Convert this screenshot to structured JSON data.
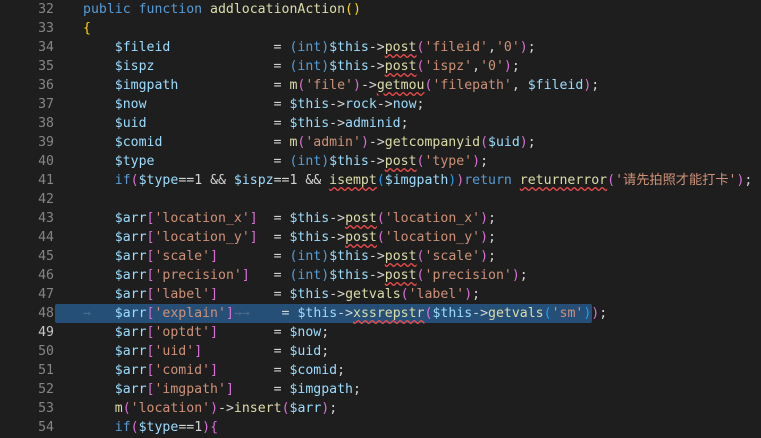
{
  "lines": [
    {
      "n": "32",
      "tokens": [
        [
          "",
          "kw",
          "public function "
        ],
        [
          "",
          "fn",
          "addlocationAction"
        ],
        [
          "",
          "br1",
          "()"
        ]
      ]
    },
    {
      "n": "33",
      "tokens": [
        [
          "",
          "br1",
          "{"
        ]
      ]
    },
    {
      "n": "34",
      "tokens": [
        [
          "",
          "plain",
          "    "
        ],
        [
          "",
          "var",
          "$fileid"
        ],
        [
          "",
          "plain",
          "             = "
        ],
        [
          "",
          "kw",
          "(int)"
        ],
        [
          "",
          "var",
          "$this"
        ],
        [
          "",
          "op",
          "->"
        ],
        [
          "",
          "fn squig",
          "post"
        ],
        [
          "",
          "br2",
          "("
        ],
        [
          "",
          "str",
          "'fileid'"
        ],
        [
          "",
          "plain",
          ","
        ],
        [
          "",
          "str",
          "'0'"
        ],
        [
          "",
          "br2",
          ")"
        ],
        [
          "",
          "plain",
          ";"
        ]
      ]
    },
    {
      "n": "35",
      "tokens": [
        [
          "",
          "plain",
          "    "
        ],
        [
          "",
          "var",
          "$ispz"
        ],
        [
          "",
          "plain",
          "               = "
        ],
        [
          "",
          "kw",
          "(int)"
        ],
        [
          "",
          "var",
          "$this"
        ],
        [
          "",
          "op",
          "->"
        ],
        [
          "",
          "fn squig",
          "post"
        ],
        [
          "",
          "br2",
          "("
        ],
        [
          "",
          "str",
          "'ispz'"
        ],
        [
          "",
          "plain",
          ","
        ],
        [
          "",
          "str",
          "'0'"
        ],
        [
          "",
          "br2",
          ")"
        ],
        [
          "",
          "plain",
          ";"
        ]
      ]
    },
    {
      "n": "36",
      "tokens": [
        [
          "",
          "plain",
          "    "
        ],
        [
          "",
          "var",
          "$imgpath"
        ],
        [
          "",
          "plain",
          "            = "
        ],
        [
          "",
          "fn",
          "m"
        ],
        [
          "",
          "br2",
          "("
        ],
        [
          "",
          "str",
          "'file'"
        ],
        [
          "",
          "br2",
          ")"
        ],
        [
          "",
          "op",
          "->"
        ],
        [
          "",
          "fn squig",
          "getmou"
        ],
        [
          "",
          "br2",
          "("
        ],
        [
          "",
          "str",
          "'filepath'"
        ],
        [
          "",
          "plain",
          ", "
        ],
        [
          "",
          "var",
          "$fileid"
        ],
        [
          "",
          "br2",
          ")"
        ],
        [
          "",
          "plain",
          ";"
        ]
      ]
    },
    {
      "n": "37",
      "tokens": [
        [
          "",
          "plain",
          "    "
        ],
        [
          "",
          "var",
          "$now"
        ],
        [
          "",
          "plain",
          "                = "
        ],
        [
          "",
          "var",
          "$this"
        ],
        [
          "",
          "op",
          "->"
        ],
        [
          "",
          "var",
          "rock"
        ],
        [
          "",
          "op",
          "->"
        ],
        [
          "",
          "var",
          "now"
        ],
        [
          "",
          "plain",
          ";"
        ]
      ]
    },
    {
      "n": "38",
      "tokens": [
        [
          "",
          "plain",
          "    "
        ],
        [
          "",
          "var",
          "$uid"
        ],
        [
          "",
          "plain",
          "                = "
        ],
        [
          "",
          "var",
          "$this"
        ],
        [
          "",
          "op",
          "->"
        ],
        [
          "",
          "var",
          "adminid"
        ],
        [
          "",
          "plain",
          ";"
        ]
      ]
    },
    {
      "n": "39",
      "tokens": [
        [
          "",
          "plain",
          "    "
        ],
        [
          "",
          "var",
          "$comid"
        ],
        [
          "",
          "plain",
          "              = "
        ],
        [
          "",
          "fn",
          "m"
        ],
        [
          "",
          "br2",
          "("
        ],
        [
          "",
          "str",
          "'admin'"
        ],
        [
          "",
          "br2",
          ")"
        ],
        [
          "",
          "op",
          "->"
        ],
        [
          "",
          "fn",
          "getcompanyid"
        ],
        [
          "",
          "br2",
          "("
        ],
        [
          "",
          "var",
          "$uid"
        ],
        [
          "",
          "br2",
          ")"
        ],
        [
          "",
          "plain",
          ";"
        ]
      ]
    },
    {
      "n": "40",
      "tokens": [
        [
          "",
          "plain",
          "    "
        ],
        [
          "",
          "var",
          "$type"
        ],
        [
          "",
          "plain",
          "               = "
        ],
        [
          "",
          "kw",
          "(int)"
        ],
        [
          "",
          "var",
          "$this"
        ],
        [
          "",
          "op",
          "->"
        ],
        [
          "",
          "fn squig",
          "post"
        ],
        [
          "",
          "br2",
          "("
        ],
        [
          "",
          "str",
          "'type'"
        ],
        [
          "",
          "br2",
          ")"
        ],
        [
          "",
          "plain",
          ";"
        ]
      ]
    },
    {
      "n": "41",
      "tokens": [
        [
          "",
          "plain",
          "    "
        ],
        [
          "",
          "kw",
          "if"
        ],
        [
          "",
          "br2",
          "("
        ],
        [
          "",
          "var",
          "$type"
        ],
        [
          "",
          "plain",
          "==1 && "
        ],
        [
          "",
          "var",
          "$ispz"
        ],
        [
          "",
          "plain",
          "==1 && "
        ],
        [
          "",
          "fn squig",
          "isempt"
        ],
        [
          "",
          "br3",
          "("
        ],
        [
          "",
          "var",
          "$imgpath"
        ],
        [
          "",
          "br3",
          ")"
        ],
        [
          "",
          "br2",
          ")"
        ],
        [
          "",
          "kw",
          "return "
        ],
        [
          "",
          "fn squig",
          "returnerror"
        ],
        [
          "",
          "br2",
          "("
        ],
        [
          "",
          "str",
          "'请先拍照才能打卡'"
        ],
        [
          "",
          "br2",
          ")"
        ],
        [
          "",
          "plain",
          ";"
        ]
      ]
    },
    {
      "n": "42",
      "tokens": []
    },
    {
      "n": "43",
      "tokens": [
        [
          "",
          "plain",
          "    "
        ],
        [
          "",
          "var",
          "$arr"
        ],
        [
          "",
          "br2",
          "["
        ],
        [
          "",
          "str",
          "'location_x'"
        ],
        [
          "",
          "br2",
          "]"
        ],
        [
          "",
          "plain",
          "  = "
        ],
        [
          "",
          "var",
          "$this"
        ],
        [
          "",
          "op",
          "->"
        ],
        [
          "",
          "fn squig",
          "post"
        ],
        [
          "",
          "br2",
          "("
        ],
        [
          "",
          "str",
          "'location_x'"
        ],
        [
          "",
          "br2",
          ")"
        ],
        [
          "",
          "plain",
          ";"
        ]
      ]
    },
    {
      "n": "44",
      "tokens": [
        [
          "",
          "plain",
          "    "
        ],
        [
          "",
          "var",
          "$arr"
        ],
        [
          "",
          "br2",
          "["
        ],
        [
          "",
          "str",
          "'location_y'"
        ],
        [
          "",
          "br2",
          "]"
        ],
        [
          "",
          "plain",
          "  = "
        ],
        [
          "",
          "var",
          "$this"
        ],
        [
          "",
          "op",
          "->"
        ],
        [
          "",
          "fn squig",
          "post"
        ],
        [
          "",
          "br2",
          "("
        ],
        [
          "",
          "str",
          "'location_y'"
        ],
        [
          "",
          "br2",
          ")"
        ],
        [
          "",
          "plain",
          ";"
        ]
      ]
    },
    {
      "n": "45",
      "tokens": [
        [
          "",
          "plain",
          "    "
        ],
        [
          "",
          "var",
          "$arr"
        ],
        [
          "",
          "br2",
          "["
        ],
        [
          "",
          "str",
          "'scale'"
        ],
        [
          "",
          "br2",
          "]"
        ],
        [
          "",
          "plain",
          "       = "
        ],
        [
          "",
          "kw",
          "(int)"
        ],
        [
          "",
          "var",
          "$this"
        ],
        [
          "",
          "op",
          "->"
        ],
        [
          "",
          "fn squig",
          "post"
        ],
        [
          "",
          "br2",
          "("
        ],
        [
          "",
          "str",
          "'scale'"
        ],
        [
          "",
          "br2",
          ")"
        ],
        [
          "",
          "plain",
          ";"
        ]
      ]
    },
    {
      "n": "46",
      "tokens": [
        [
          "",
          "plain",
          "    "
        ],
        [
          "",
          "var",
          "$arr"
        ],
        [
          "",
          "br2",
          "["
        ],
        [
          "",
          "str",
          "'precision'"
        ],
        [
          "",
          "br2",
          "]"
        ],
        [
          "",
          "plain",
          "   = "
        ],
        [
          "",
          "kw",
          "(int)"
        ],
        [
          "",
          "var",
          "$this"
        ],
        [
          "",
          "op",
          "->"
        ],
        [
          "",
          "fn squig",
          "post"
        ],
        [
          "",
          "br2",
          "("
        ],
        [
          "",
          "str",
          "'precision'"
        ],
        [
          "",
          "br2",
          ")"
        ],
        [
          "",
          "plain",
          ";"
        ]
      ]
    },
    {
      "n": "47",
      "tokens": [
        [
          "",
          "plain",
          "    "
        ],
        [
          "",
          "var",
          "$arr"
        ],
        [
          "",
          "br2",
          "["
        ],
        [
          "",
          "str",
          "'label'"
        ],
        [
          "",
          "br2",
          "]"
        ],
        [
          "",
          "plain",
          "       = "
        ],
        [
          "",
          "var",
          "$this"
        ],
        [
          "",
          "op",
          "->"
        ],
        [
          "",
          "fn",
          "getvals"
        ],
        [
          "",
          "br2",
          "("
        ],
        [
          "",
          "str",
          "'label'"
        ],
        [
          "",
          "br2",
          ")"
        ],
        [
          "",
          "plain",
          ";"
        ]
      ]
    },
    {
      "n": "48",
      "selected": true,
      "tokens": [
        [
          "",
          "ws",
          "→   "
        ],
        [
          "",
          "var",
          "$arr"
        ],
        [
          "",
          "br2",
          "["
        ],
        [
          "",
          "str",
          "'explain'"
        ],
        [
          "",
          "br2",
          "]"
        ],
        [
          "",
          "ws",
          "→→  "
        ],
        [
          "",
          "plain",
          "  = "
        ],
        [
          "",
          "var",
          "$this"
        ],
        [
          "",
          "op",
          "->"
        ],
        [
          "",
          "fn squig",
          "xssrepstr"
        ],
        [
          "",
          "br2",
          "("
        ],
        [
          "",
          "var",
          "$this"
        ],
        [
          "",
          "op",
          "->"
        ],
        [
          "",
          "fn",
          "getvals"
        ],
        [
          "",
          "br3",
          "("
        ],
        [
          "",
          "str",
          "'sm'"
        ],
        [
          "",
          "br3",
          ")"
        ],
        [
          "",
          "br2",
          ")"
        ],
        [
          "",
          "plain",
          ";"
        ]
      ]
    },
    {
      "n": "49",
      "active": true,
      "tokens": [
        [
          "",
          "plain",
          "    "
        ],
        [
          "",
          "var",
          "$arr"
        ],
        [
          "",
          "br2",
          "["
        ],
        [
          "",
          "str",
          "'optdt'"
        ],
        [
          "",
          "br2",
          "]"
        ],
        [
          "",
          "plain",
          "       = "
        ],
        [
          "",
          "var",
          "$now"
        ],
        [
          "",
          "plain",
          ";"
        ]
      ]
    },
    {
      "n": "50",
      "tokens": [
        [
          "",
          "plain",
          "    "
        ],
        [
          "",
          "var",
          "$arr"
        ],
        [
          "",
          "br2",
          "["
        ],
        [
          "",
          "str",
          "'uid'"
        ],
        [
          "",
          "br2",
          "]"
        ],
        [
          "",
          "plain",
          "         = "
        ],
        [
          "",
          "var",
          "$uid"
        ],
        [
          "",
          "plain",
          ";"
        ]
      ]
    },
    {
      "n": "51",
      "tokens": [
        [
          "",
          "plain",
          "    "
        ],
        [
          "",
          "var",
          "$arr"
        ],
        [
          "",
          "br2",
          "["
        ],
        [
          "",
          "str",
          "'comid'"
        ],
        [
          "",
          "br2",
          "]"
        ],
        [
          "",
          "plain",
          "       = "
        ],
        [
          "",
          "var",
          "$comid"
        ],
        [
          "",
          "plain",
          ";"
        ]
      ]
    },
    {
      "n": "52",
      "tokens": [
        [
          "",
          "plain",
          "    "
        ],
        [
          "",
          "var",
          "$arr"
        ],
        [
          "",
          "br2",
          "["
        ],
        [
          "",
          "str",
          "'imgpath'"
        ],
        [
          "",
          "br2",
          "]"
        ],
        [
          "",
          "plain",
          "     = "
        ],
        [
          "",
          "var",
          "$imgpath"
        ],
        [
          "",
          "plain",
          ";"
        ]
      ]
    },
    {
      "n": "53",
      "tokens": [
        [
          "",
          "plain",
          "    "
        ],
        [
          "",
          "fn",
          "m"
        ],
        [
          "",
          "br2",
          "("
        ],
        [
          "",
          "str",
          "'location'"
        ],
        [
          "",
          "br2",
          ")"
        ],
        [
          "",
          "op",
          "->"
        ],
        [
          "",
          "fn",
          "insert"
        ],
        [
          "",
          "br2",
          "("
        ],
        [
          "",
          "var",
          "$arr"
        ],
        [
          "",
          "br2",
          ")"
        ],
        [
          "",
          "plain",
          ";"
        ]
      ]
    },
    {
      "n": "54",
      "tokens": [
        [
          "",
          "plain",
          "    "
        ],
        [
          "",
          "kw",
          "if"
        ],
        [
          "",
          "br2",
          "("
        ],
        [
          "",
          "var",
          "$type"
        ],
        [
          "",
          "plain",
          "==1"
        ],
        [
          "",
          "br2",
          ")"
        ],
        [
          "",
          "br2",
          "{"
        ]
      ]
    }
  ]
}
